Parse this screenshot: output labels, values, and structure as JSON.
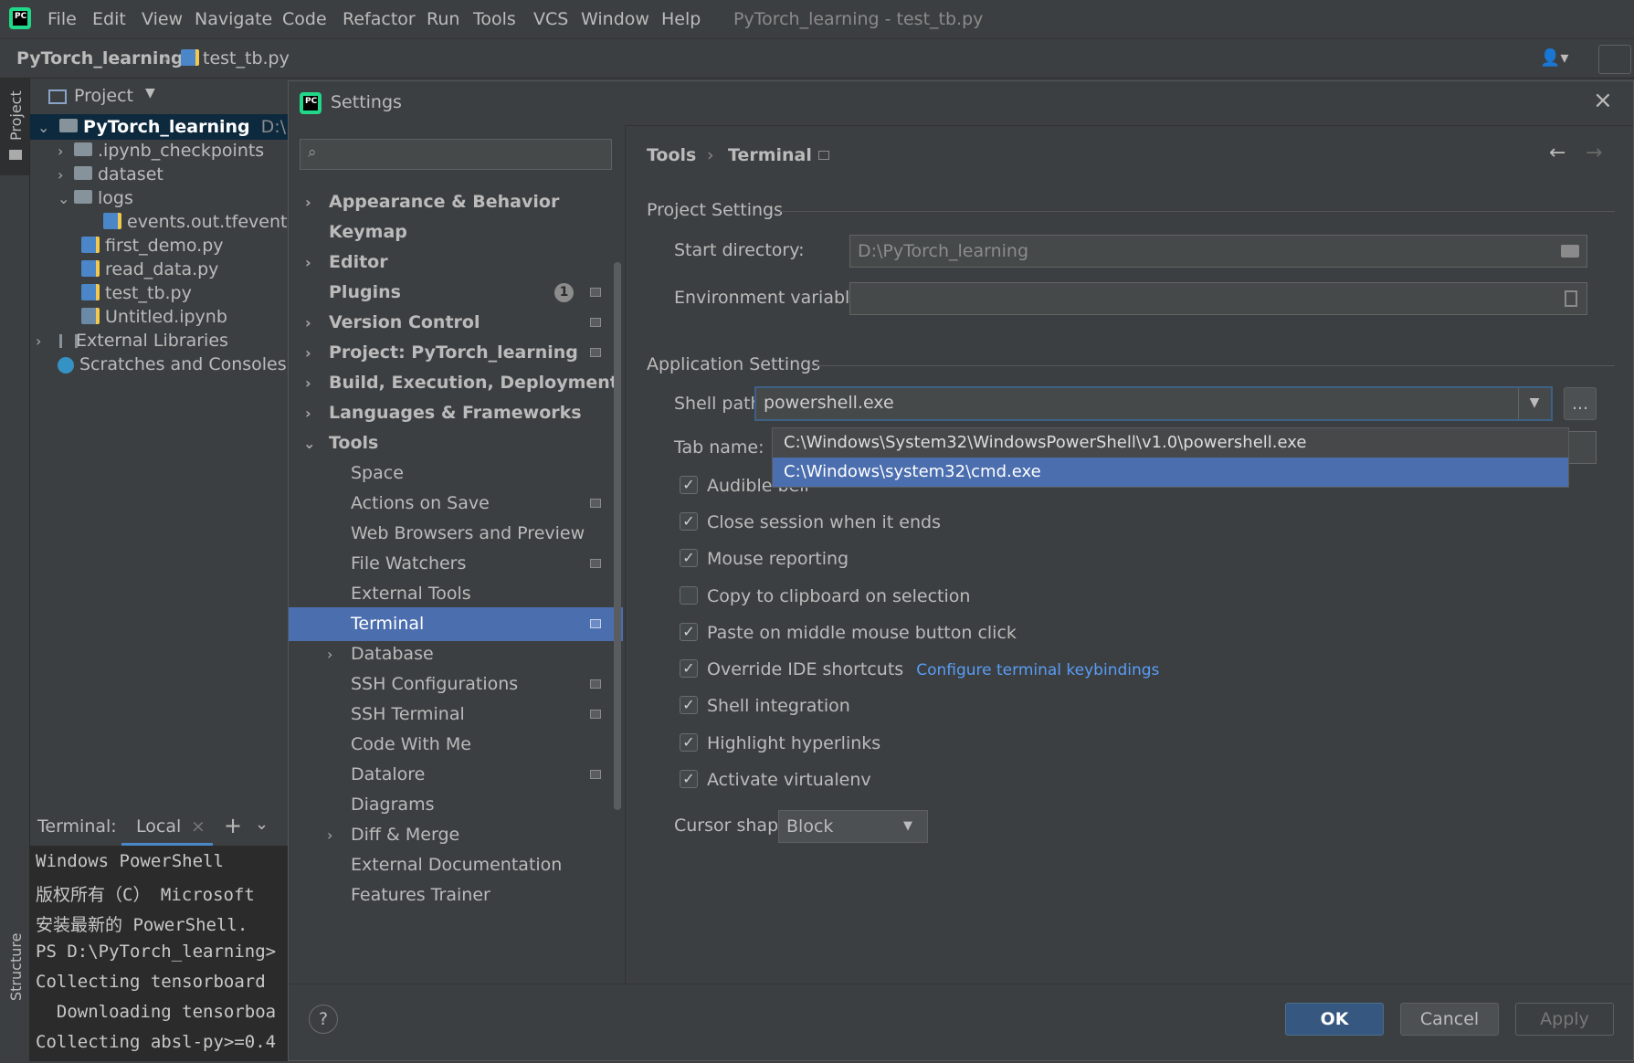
{
  "menubar": {
    "items": [
      "File",
      "Edit",
      "View",
      "Navigate",
      "Code",
      "Refactor",
      "Run",
      "Tools",
      "VCS",
      "Window",
      "Help"
    ],
    "title": "PyTorch_learning - test_tb.py"
  },
  "navbar": {
    "project": "PyTorch_learning",
    "file": "test_tb.py"
  },
  "stripe": {
    "project_label": "Project",
    "structure_label": "Structure"
  },
  "project_panel": {
    "header": "Project",
    "root": {
      "name": "PyTorch_learning",
      "path": "D:\\PyT"
    },
    "items": [
      ".ipynb_checkpoints",
      "dataset",
      "logs",
      "events.out.tfevents.",
      "first_demo.py",
      "read_data.py",
      "test_tb.py",
      "Untitled.ipynb",
      "External Libraries",
      "Scratches and Consoles"
    ]
  },
  "terminal": {
    "label": "Terminal:",
    "tab": "Local",
    "lines": [
      "Windows PowerShell",
      "版权所有（C） Microsoft",
      "安装最新的 PowerShell.",
      "PS D:\\PyTorch_learning>",
      "Collecting tensorboard",
      "  Downloading tensorboa",
      "Collecting absl-py>=0.4"
    ]
  },
  "dialog": {
    "title": "Settings",
    "search_placeholder": "",
    "sidebar": [
      "Appearance & Behavior",
      "Keymap",
      "Editor",
      "Plugins",
      "Version Control",
      "Project: PyTorch_learning",
      "Build, Execution, Deployment",
      "Languages & Frameworks",
      "Tools",
      "Space",
      "Actions on Save",
      "Web Browsers and Preview",
      "File Watchers",
      "External Tools",
      "Terminal",
      "Database",
      "SSH Configurations",
      "SSH Terminal",
      "Code With Me",
      "Datalore",
      "Diagrams",
      "Diff & Merge",
      "External Documentation",
      "Features Trainer"
    ],
    "plugins_badge": "1",
    "breadcrumb": {
      "parent": "Tools",
      "current": "Terminal"
    },
    "project_settings": {
      "label": "Project Settings",
      "start_dir_label": "Start directory:",
      "start_dir_value": "D:\\PyTorch_learning",
      "env_label": "Environment variables:",
      "env_value": ""
    },
    "app_settings": {
      "label": "Application Settings",
      "shell_label": "Shell path:",
      "shell_value": "powershell.exe",
      "browse": "...",
      "tab_label": "Tab name:",
      "shell_options": [
        "C:\\Windows\\System32\\WindowsPowerShell\\v1.0\\powershell.exe",
        "C:\\Windows\\system32\\cmd.exe"
      ],
      "checkboxes": [
        {
          "label": "Audible bell",
          "checked": true
        },
        {
          "label": "Close session when it ends",
          "checked": true
        },
        {
          "label": "Mouse reporting",
          "checked": true
        },
        {
          "label": "Copy to clipboard on selection",
          "checked": false
        },
        {
          "label": "Paste on middle mouse button click",
          "checked": true
        },
        {
          "label": "Override IDE shortcuts",
          "checked": true
        },
        {
          "label": "Shell integration",
          "checked": true
        },
        {
          "label": "Highlight hyperlinks",
          "checked": true
        },
        {
          "label": "Activate virtualenv",
          "checked": true
        }
      ],
      "keybindings_link": "Configure terminal keybindings",
      "cursor_label": "Cursor shape:",
      "cursor_value": "Block"
    },
    "buttons": {
      "ok": "OK",
      "cancel": "Cancel",
      "apply": "Apply",
      "help": "?"
    }
  },
  "colors": {
    "selection": "#4b6eaf",
    "link": "#589df6",
    "ok_button": "#365880"
  }
}
